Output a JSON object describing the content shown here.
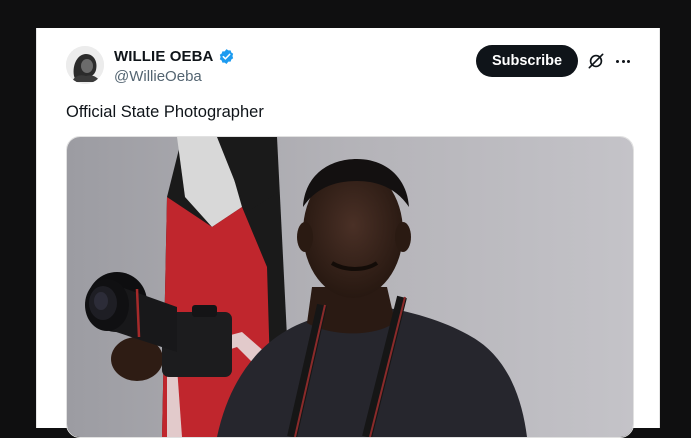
{
  "post": {
    "author": {
      "display_name": "WILLIE OEBA",
      "handle": "@WillieOeba",
      "verified": true,
      "verified_color": "#1d9bf0"
    },
    "subscribe_label": "Subscribe",
    "text": "Official State Photographer",
    "media": {
      "type": "photo",
      "subject": "man in dark t-shirt holding a camera in front of Kenyan flag"
    },
    "icons": [
      "grok-icon",
      "more-icon"
    ]
  },
  "colors": {
    "background": "#0f0f10",
    "card": "#ffffff",
    "button": "#0f1419",
    "text_primary": "#0f1419",
    "text_secondary": "#536471"
  }
}
